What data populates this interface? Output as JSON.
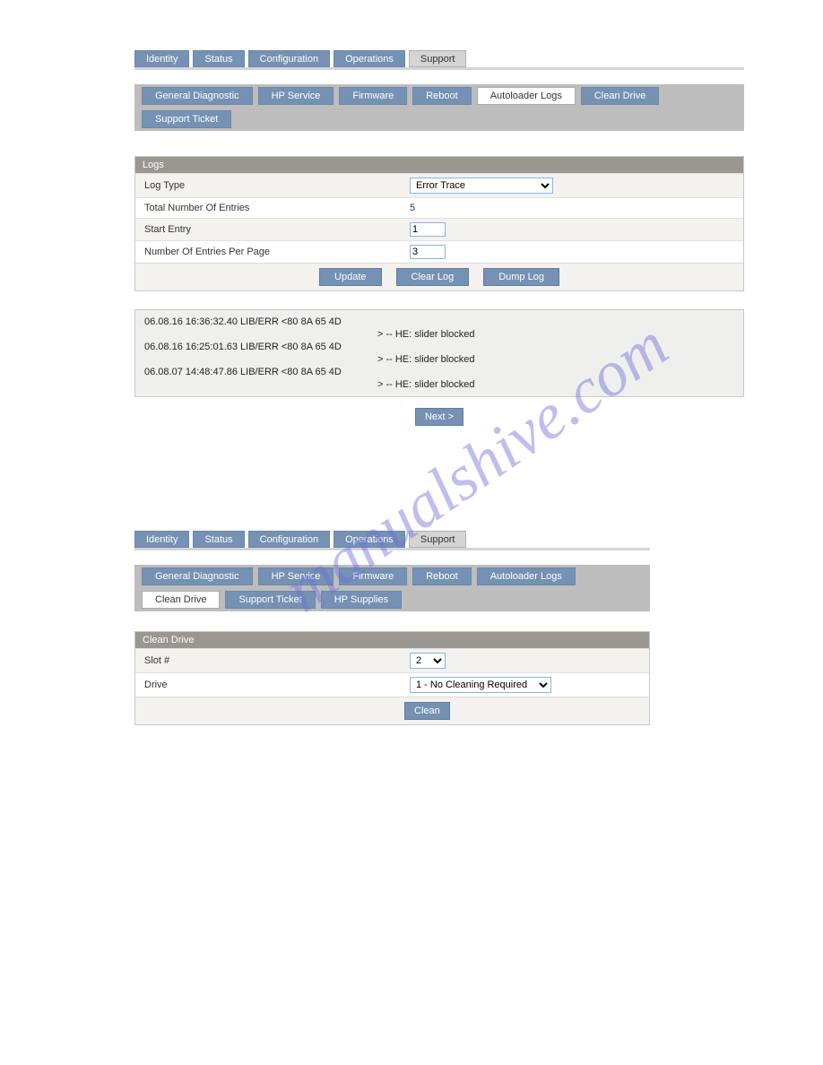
{
  "watermark": "manualshive.com",
  "panel1": {
    "mainTabs": [
      {
        "label": "Identity",
        "active": false
      },
      {
        "label": "Status",
        "active": false
      },
      {
        "label": "Configuration",
        "active": false
      },
      {
        "label": "Operations",
        "active": false
      },
      {
        "label": "Support",
        "active": true
      }
    ],
    "subTabs": [
      {
        "label": "General Diagnostic",
        "active": false
      },
      {
        "label": "HP Service",
        "active": false
      },
      {
        "label": "Firmware",
        "active": false
      },
      {
        "label": "Reboot",
        "active": false
      },
      {
        "label": "Autoloader Logs",
        "active": true
      },
      {
        "label": "Clean Drive",
        "active": false
      },
      {
        "label": "Support Ticket",
        "active": false
      }
    ],
    "section_title": "Logs",
    "fields": {
      "log_type_label": "Log Type",
      "log_type_value": "Error Trace",
      "total_label": "Total Number Of Entries",
      "total_value": "5",
      "start_label": "Start Entry",
      "start_value": "1",
      "per_page_label": "Number Of Entries Per Page",
      "per_page_value": "3"
    },
    "buttons": {
      "update": "Update",
      "clear": "Clear Log",
      "dump": "Dump Log"
    },
    "log_entries": [
      {
        "line": "06.08.16 16:36:32.40 LIB/ERR <80 8A 65 4D",
        "detail": "> -- HE: slider blocked"
      },
      {
        "line": "06.08.16 16:25:01.63 LIB/ERR <80 8A 65 4D",
        "detail": "> -- HE: slider blocked"
      },
      {
        "line": "06.08.07 14:48:47.86 LIB/ERR <80 8A 65 4D",
        "detail": "> -- HE: slider blocked"
      }
    ],
    "next_label": "Next >"
  },
  "panel2": {
    "mainTabs": [
      {
        "label": "Identity",
        "active": false
      },
      {
        "label": "Status",
        "active": false
      },
      {
        "label": "Configuration",
        "active": false
      },
      {
        "label": "Operations",
        "active": false
      },
      {
        "label": "Support",
        "active": true
      }
    ],
    "subTabs": [
      {
        "label": "General Diagnostic",
        "active": false
      },
      {
        "label": "HP Service",
        "active": false
      },
      {
        "label": "Firmware",
        "active": false
      },
      {
        "label": "Reboot",
        "active": false
      },
      {
        "label": "Autoloader Logs",
        "active": false
      },
      {
        "label": "Clean Drive",
        "active": true
      },
      {
        "label": "Support Ticket",
        "active": false
      },
      {
        "label": "HP Supplies",
        "active": false
      }
    ],
    "section_title": "Clean Drive",
    "fields": {
      "slot_label": "Slot #",
      "slot_value": "2",
      "drive_label": "Drive",
      "drive_value": "1 - No Cleaning Required"
    },
    "buttons": {
      "clean": "Clean"
    }
  }
}
